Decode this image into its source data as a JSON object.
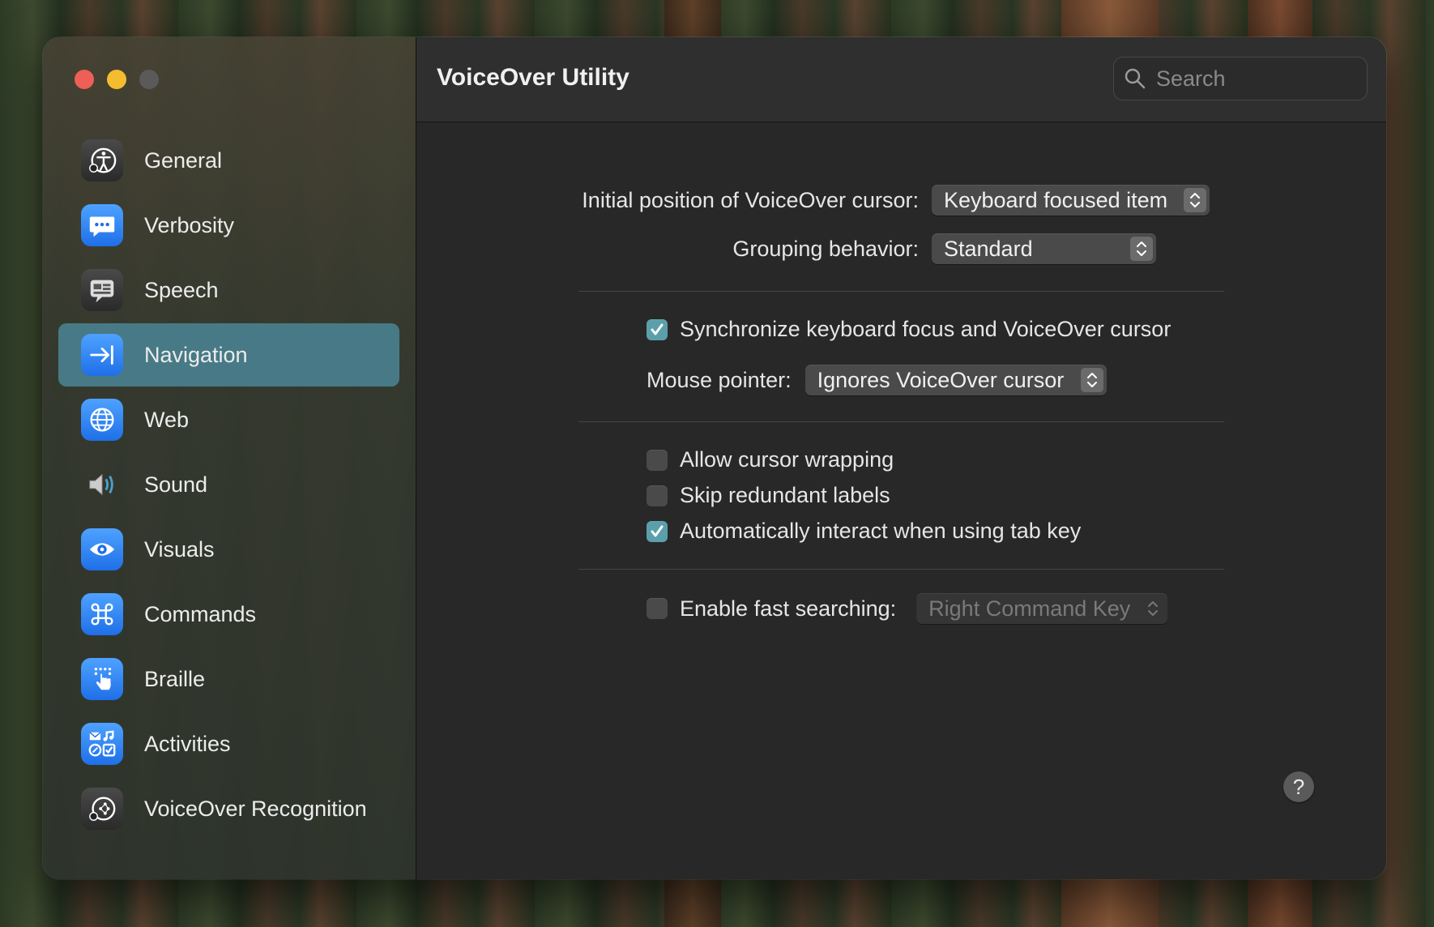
{
  "window": {
    "title": "VoiceOver Utility",
    "search_placeholder": "Search"
  },
  "sidebar": {
    "items": [
      {
        "label": "General",
        "icon": "accessibility-person-icon",
        "selected": false
      },
      {
        "label": "Verbosity",
        "icon": "speech-bubble-dots-icon",
        "selected": false
      },
      {
        "label": "Speech",
        "icon": "speech-icon",
        "selected": false
      },
      {
        "label": "Navigation",
        "icon": "arrow-to-bar-icon",
        "selected": true
      },
      {
        "label": "Web",
        "icon": "globe-icon",
        "selected": false
      },
      {
        "label": "Sound",
        "icon": "speaker-icon",
        "selected": false
      },
      {
        "label": "Visuals",
        "icon": "eye-icon",
        "selected": false
      },
      {
        "label": "Commands",
        "icon": "command-key-icon",
        "selected": false
      },
      {
        "label": "Braille",
        "icon": "braille-hand-icon",
        "selected": false
      },
      {
        "label": "Activities",
        "icon": "activities-grid-icon",
        "selected": false
      },
      {
        "label": "VoiceOver Recognition",
        "icon": "recognition-icon",
        "selected": false
      }
    ]
  },
  "navigation": {
    "initial_position_label": "Initial position of VoiceOver cursor:",
    "initial_position_value": "Keyboard focused item",
    "grouping_label": "Grouping behavior:",
    "grouping_value": "Standard",
    "sync_label": "Synchronize keyboard focus and VoiceOver cursor",
    "sync_checked": true,
    "mouse_pointer_label": "Mouse pointer:",
    "mouse_pointer_value": "Ignores VoiceOver cursor",
    "wrap_label": "Allow cursor wrapping",
    "wrap_checked": false,
    "skip_label": "Skip redundant labels",
    "skip_checked": false,
    "auto_interact_label": "Automatically interact when using tab key",
    "auto_interact_checked": true,
    "fast_search_label": "Enable fast searching:",
    "fast_search_checked": false,
    "fast_search_key": "Right Command Key",
    "help_label": "?"
  },
  "colors": {
    "accent": "#477a86",
    "checkbox_checked": "#5b9fab"
  }
}
